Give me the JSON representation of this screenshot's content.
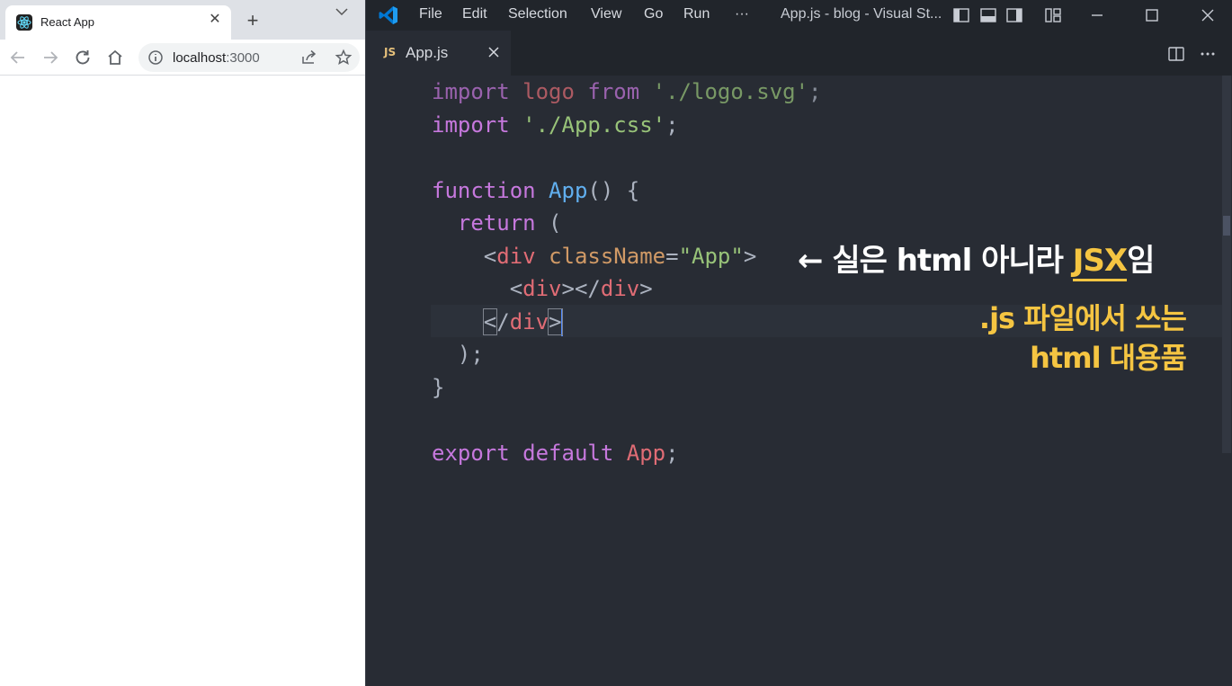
{
  "browser": {
    "tab": {
      "title": "React App",
      "close": "✕"
    },
    "new_tab": "+",
    "address": {
      "host": "localhost",
      "port": ":3000"
    }
  },
  "vscode": {
    "menu": [
      "File",
      "Edit",
      "Selection",
      "View",
      "Go",
      "Run",
      "···"
    ],
    "window_title": "App.js - blog - Visual St...",
    "tab": {
      "icon": "JS",
      "label": "App.js"
    },
    "code_lines": [
      [
        {
          "t": "import",
          "c": "k dim"
        },
        {
          "t": " logo ",
          "c": "i dim"
        },
        {
          "t": "from",
          "c": "k dim"
        },
        {
          "t": " './logo.svg'",
          "c": "s dim"
        },
        {
          "t": ";",
          "c": "p dim"
        }
      ],
      [
        {
          "t": "import",
          "c": "k"
        },
        {
          "t": " './App.css'",
          "c": "s"
        },
        {
          "t": ";",
          "c": "p"
        }
      ],
      [],
      [
        {
          "t": "function",
          "c": "k"
        },
        {
          "t": " ",
          "c": "p"
        },
        {
          "t": "App",
          "c": "f"
        },
        {
          "t": "() {",
          "c": "p"
        }
      ],
      [
        {
          "t": "  return",
          "c": "k"
        },
        {
          "t": " (",
          "c": "p"
        }
      ],
      [
        {
          "t": "    <",
          "c": "p"
        },
        {
          "t": "div",
          "c": "i"
        },
        {
          "t": " ",
          "c": "p"
        },
        {
          "t": "className",
          "c": "a"
        },
        {
          "t": "=",
          "c": "p"
        },
        {
          "t": "\"App\"",
          "c": "s"
        },
        {
          "t": ">",
          "c": "p"
        }
      ],
      [
        {
          "t": "      <",
          "c": "p"
        },
        {
          "t": "div",
          "c": "i"
        },
        {
          "t": "></",
          "c": "p"
        },
        {
          "t": "div",
          "c": "i"
        },
        {
          "t": ">",
          "c": "p"
        }
      ],
      [
        {
          "t": "    ",
          "c": "p"
        },
        {
          "t": "<",
          "c": "p bracket-box"
        },
        {
          "t": "/",
          "c": "p"
        },
        {
          "t": "div",
          "c": "i"
        },
        {
          "t": ">",
          "c": "p bracket-box"
        },
        {
          "t": "",
          "c": "cursor"
        }
      ],
      [
        {
          "t": "  );",
          "c": "p"
        }
      ],
      [
        {
          "t": "}",
          "c": "p"
        }
      ],
      [],
      [
        {
          "t": "export",
          "c": "k"
        },
        {
          "t": " ",
          "c": "p"
        },
        {
          "t": "default",
          "c": "k"
        },
        {
          "t": " ",
          "c": "p"
        },
        {
          "t": "App",
          "c": "i"
        },
        {
          "t": ";",
          "c": "p"
        }
      ]
    ],
    "annotation": {
      "line1_pre": "← 실은 html 아니라 ",
      "line1_hl": "JSX",
      "line1_post": "임",
      "line2": ".js 파일에서 쓰는",
      "line3": "html 대용품"
    }
  }
}
